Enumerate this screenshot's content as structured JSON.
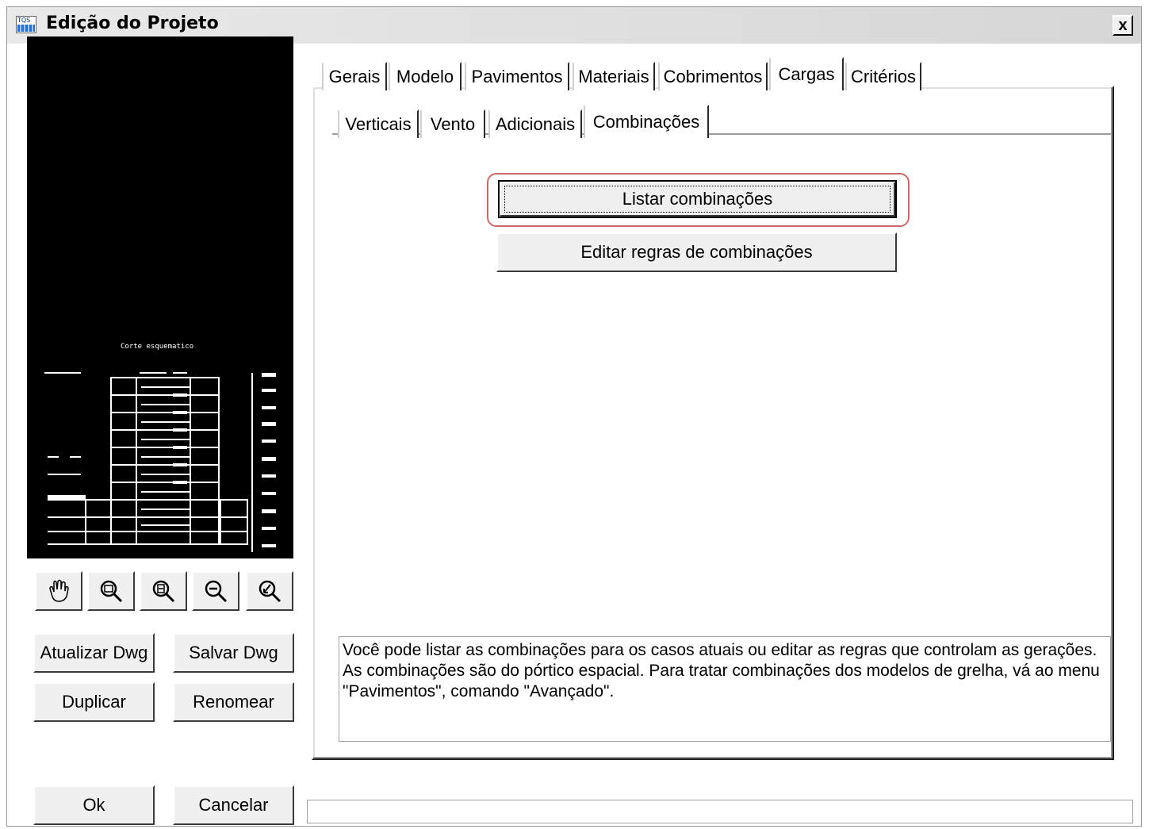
{
  "window": {
    "title": "Edição do Projeto",
    "app_icon_text": "TQS",
    "close_glyph": "x"
  },
  "preview": {
    "caption": "Corte esquematico"
  },
  "toolbar": {
    "icons": [
      "pan-hand-icon",
      "zoom-window-icon",
      "zoom-extents-icon",
      "zoom-out-icon",
      "zoom-previous-icon"
    ]
  },
  "buttons": {
    "update_dwg": "Atualizar Dwg",
    "save_dwg": "Salvar Dwg",
    "duplicate": "Duplicar",
    "rename": "Renomear",
    "ok": "Ok",
    "cancel": "Cancelar"
  },
  "tabs": [
    "Gerais",
    "Modelo",
    "Pavimentos",
    "Materiais",
    "Cobrimentos",
    "Cargas",
    "Critérios"
  ],
  "active_tab": "Cargas",
  "subtabs": [
    "Verticais",
    "Vento",
    "Adicionais",
    "Combinações"
  ],
  "active_subtab": "Combinações",
  "actions": {
    "list_combinations": "Listar combinações",
    "edit_rules": "Editar regras de combinações"
  },
  "description": "Você pode listar as combinações para os casos atuais ou editar as regras que controlam as gerações. As combinações são do pórtico espacial. Para tratar combinações dos modelos de grelha, vá ao menu \"Pavimentos\", comando \"Avançado\".",
  "colors": {
    "highlight": "#c96a6a",
    "preview_bg": "#000000"
  }
}
